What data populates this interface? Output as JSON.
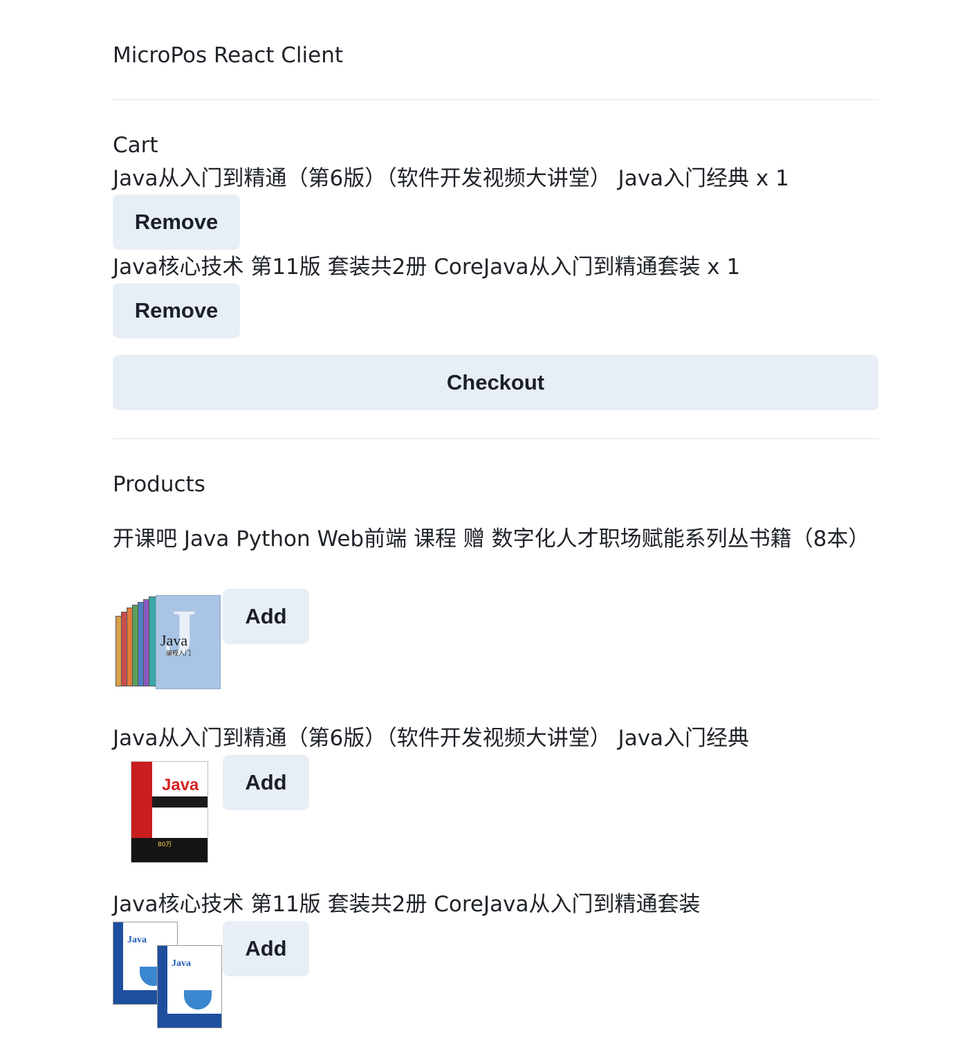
{
  "app": {
    "title": "MicroPos React Client"
  },
  "cart": {
    "heading": "Cart",
    "items": [
      {
        "label": "Java从入门到精通（第6版）（软件开发视频大讲堂） Java入门经典 x 1",
        "remove_label": "Remove"
      },
      {
        "label": "Java核心技术 第11版 套装共2册 CoreJava从入门到精通套装 x 1",
        "remove_label": "Remove"
      }
    ],
    "checkout_label": "Checkout"
  },
  "products": {
    "heading": "Products",
    "items": [
      {
        "name": "开课吧 Java Python Web前端 课程 赠 数字化人才职场赋能系列丛书籍（8本）",
        "add_label": "Add",
        "image_icon": "java-book-set-cover"
      },
      {
        "name": "Java从入门到精通（第6版）（软件开发视频大讲堂） Java入门经典",
        "add_label": "Add",
        "image_icon": "java-book-cover"
      },
      {
        "name": "Java核心技术 第11版 套装共2册 CoreJava从入门到精通套装",
        "add_label": "Add",
        "image_icon": "core-java-volumes-cover"
      }
    ]
  },
  "colors": {
    "button_bg": "#e8eef5",
    "divider": "#eef0f2",
    "text": "#1f2329"
  }
}
